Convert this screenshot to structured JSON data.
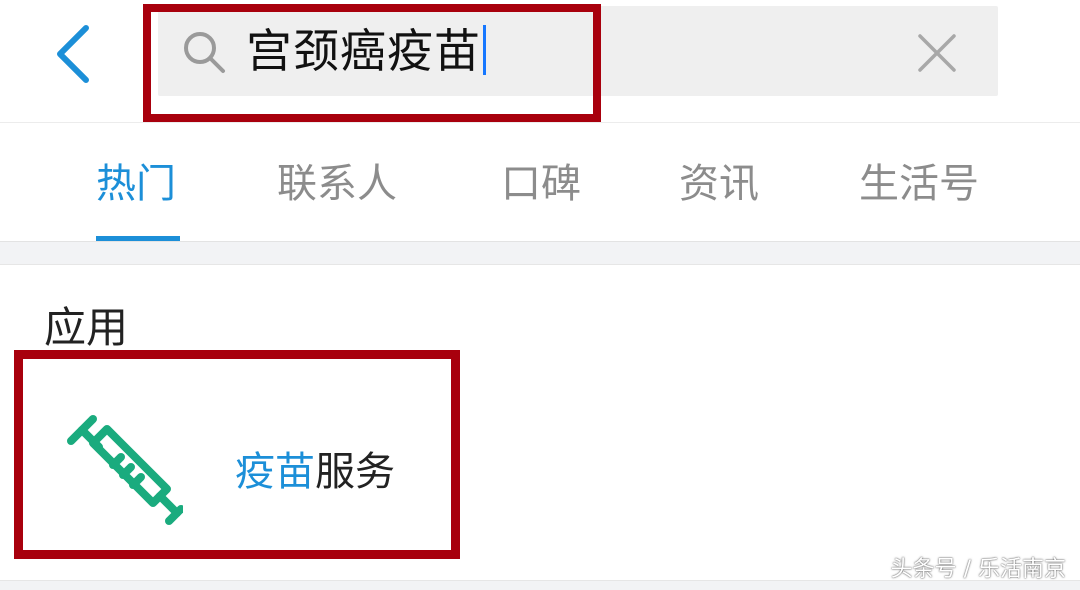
{
  "search": {
    "query": "宫颈癌疫苗",
    "back_icon": "chevron-left-icon",
    "search_icon": "search-icon",
    "clear_icon": "close-icon"
  },
  "tabs": [
    {
      "label": "热门",
      "active": true
    },
    {
      "label": "联系人",
      "active": false
    },
    {
      "label": "口碑",
      "active": false
    },
    {
      "label": "资讯",
      "active": false
    },
    {
      "label": "生活号",
      "active": false
    }
  ],
  "section": {
    "title": "应用"
  },
  "app": {
    "label_highlight": "疫苗",
    "label_rest": "服务",
    "icon": "syringe-icon"
  },
  "watermark": "头条号 / 乐活南京",
  "colors": {
    "accent": "#1c8fd8",
    "highlight_box": "#a8000d",
    "icon_green": "#1aab7e"
  }
}
